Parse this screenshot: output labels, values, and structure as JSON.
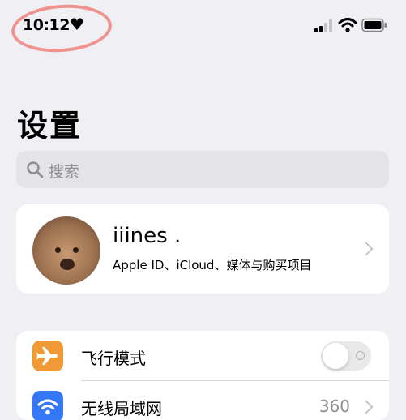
{
  "status_bar": {
    "time": "10:12",
    "heart_icon": "heart-icon",
    "signal_icon": "cellular-signal-icon",
    "wifi_icon": "wifi-icon",
    "battery_icon": "battery-icon"
  },
  "page": {
    "title": "设置"
  },
  "search": {
    "placeholder": "搜索",
    "icon": "search-icon"
  },
  "profile": {
    "name": "iiines .",
    "subtitle": "Apple ID、iCloud、媒体与购买项目"
  },
  "settings": {
    "items": [
      {
        "label": "飞行模式",
        "icon": "airplane-icon",
        "icon_color": "#f09a37",
        "control": "toggle",
        "toggle_on": false
      },
      {
        "label": "无线局域网",
        "icon": "wifi-icon",
        "icon_color": "#3478f6",
        "value": "360"
      }
    ]
  },
  "colors": {
    "background": "#efeff4",
    "highlight_circle": "#ee827d",
    "toggle_off": "#e9e9ea"
  }
}
